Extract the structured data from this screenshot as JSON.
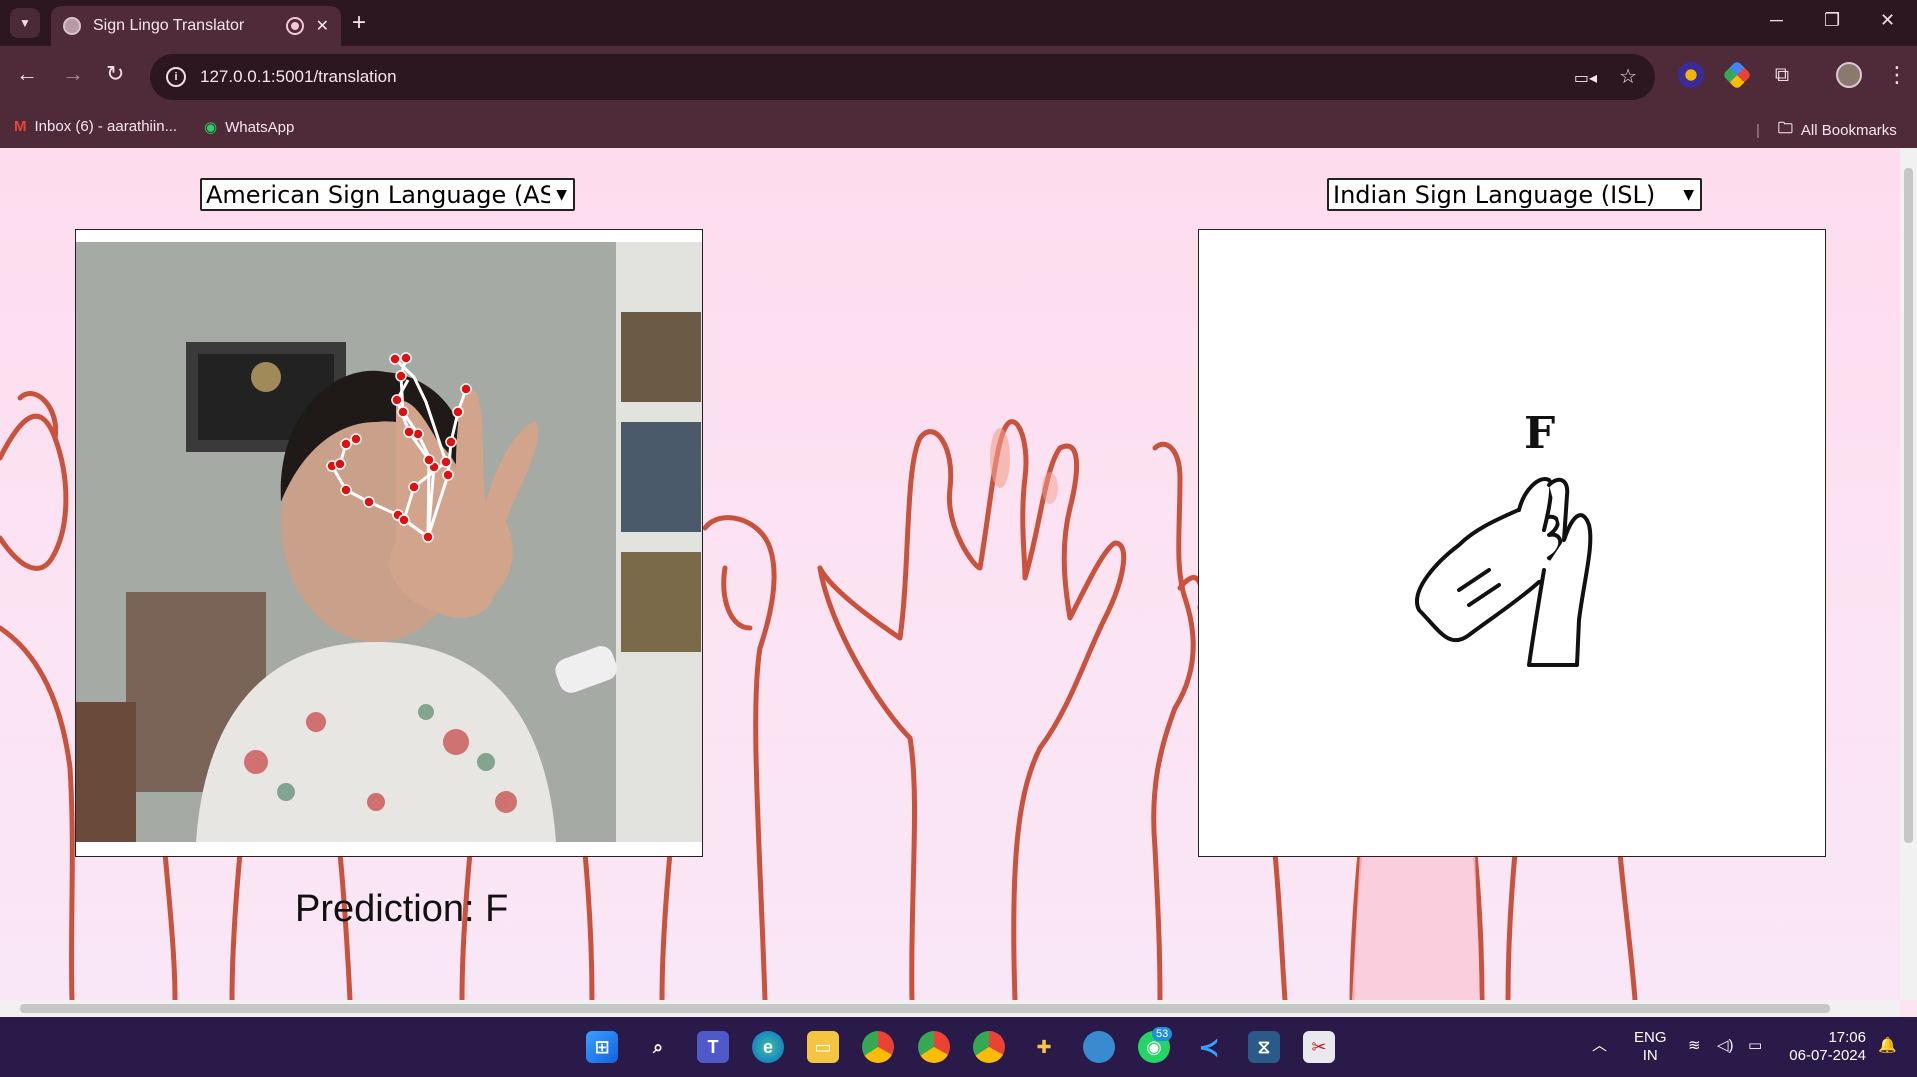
{
  "browser": {
    "tab_title": "Sign Lingo Translator",
    "url": "127.0.0.1:5001/translation",
    "bookmarks": [
      {
        "label": "Inbox (6) - aarathiin..."
      },
      {
        "label": "WhatsApp"
      }
    ],
    "all_bookmarks": "All Bookmarks"
  },
  "page": {
    "source_language": "American Sign Language (ASL)",
    "target_language": "Indian Sign Language (ISL)",
    "prediction": "Prediction: F",
    "sign_letter": "F"
  },
  "taskbar": {
    "language_line1": "ENG",
    "language_line2": "IN",
    "time": "17:06",
    "date": "06-07-2024",
    "whatsapp_badge": "53"
  },
  "colors": {
    "page_bg": "#fce4f0",
    "hand_stroke": "#c9523c",
    "chrome_dark": "#2c1620",
    "chrome_mid": "#4f2b39",
    "taskbar": "#2a1a4a"
  }
}
